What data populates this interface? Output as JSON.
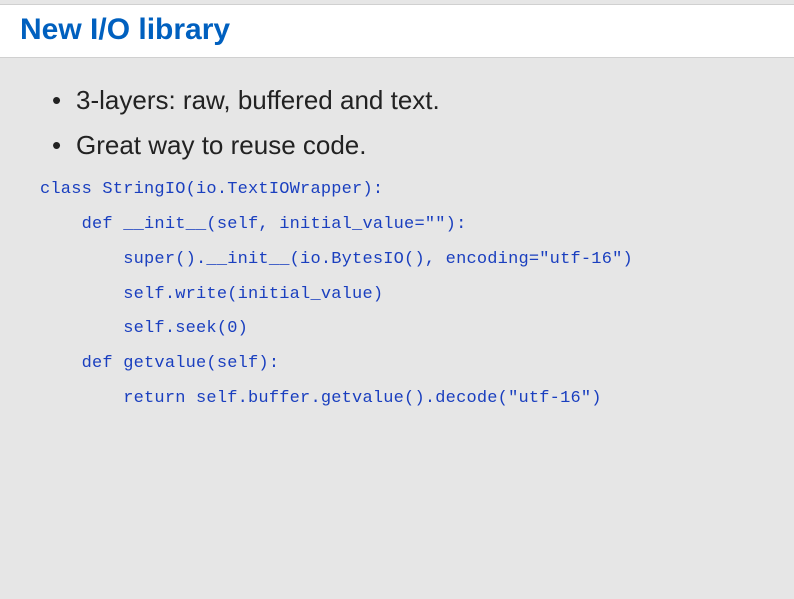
{
  "title": "New I/O library",
  "bullets": [
    "3-layers: raw, buffered and text.",
    "Great way to reuse code."
  ],
  "code": "class StringIO(io.TextIOWrapper):\n    def __init__(self, initial_value=\"\"):\n        super().__init__(io.BytesIO(), encoding=\"utf-16\")\n        self.write(initial_value)\n        self.seek(0)\n    def getvalue(self):\n        return self.buffer.getvalue().decode(\"utf-16\")"
}
